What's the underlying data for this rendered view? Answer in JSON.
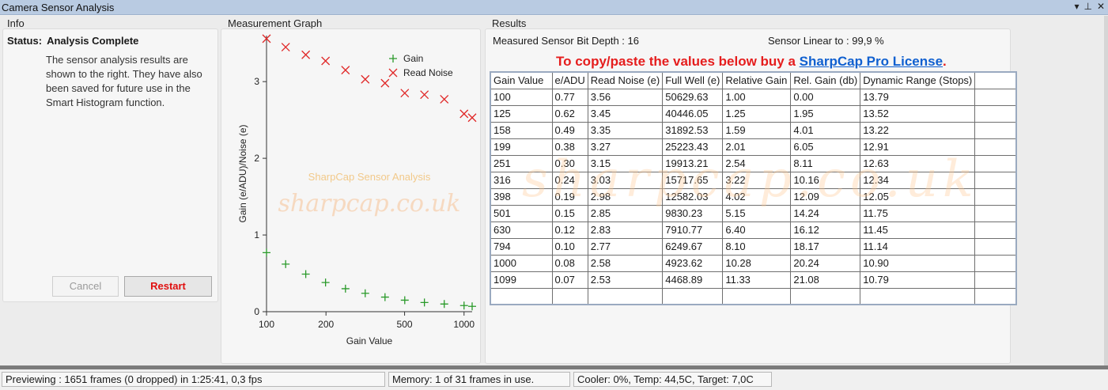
{
  "window": {
    "title": "Camera Sensor Analysis",
    "controls": [
      "▾",
      "⊥",
      "✕"
    ]
  },
  "info": {
    "title": "Info",
    "status_label": "Status:",
    "status_value": "Analysis Complete",
    "description": "The sensor analysis results are shown to the right. They have also been saved for future use in the Smart Histogram function.",
    "cancel_label": "Cancel",
    "restart_label": "Restart"
  },
  "graph": {
    "title": "Measurement Graph",
    "watermark_title": "SharpCap Sensor Analysis",
    "watermark_url": "sharpcap.co.uk"
  },
  "results": {
    "title": "Results",
    "bit_depth_label": "Measured Sensor Bit Depth :",
    "bit_depth_value": "16",
    "linear_label": "Sensor Linear to :",
    "linear_value": "99,9 %",
    "promo_text": "To copy/paste the values below buy a ",
    "promo_link": "SharpCap Pro License",
    "promo_end": ".",
    "watermark": "sharpcap.co.uk",
    "columns": [
      "Gain Value",
      "e/ADU",
      "Read Noise (e)",
      "Full Well (e)",
      "Relative Gain",
      "Rel. Gain (db)",
      "Dynamic Range (Stops)"
    ],
    "rows": [
      [
        "100",
        "0.77",
        "3.56",
        "50629.63",
        "1.00",
        "0.00",
        "13.79"
      ],
      [
        "125",
        "0.62",
        "3.45",
        "40446.05",
        "1.25",
        "1.95",
        "13.52"
      ],
      [
        "158",
        "0.49",
        "3.35",
        "31892.53",
        "1.59",
        "4.01",
        "13.22"
      ],
      [
        "199",
        "0.38",
        "3.27",
        "25223.43",
        "2.01",
        "6.05",
        "12.91"
      ],
      [
        "251",
        "0.30",
        "3.15",
        "19913.21",
        "2.54",
        "8.11",
        "12.63"
      ],
      [
        "316",
        "0.24",
        "3.03",
        "15717.65",
        "3.22",
        "10.16",
        "12.34"
      ],
      [
        "398",
        "0.19",
        "2.98",
        "12582.03",
        "4.02",
        "12.09",
        "12.05"
      ],
      [
        "501",
        "0.15",
        "2.85",
        "9830.23",
        "5.15",
        "14.24",
        "11.75"
      ],
      [
        "630",
        "0.12",
        "2.83",
        "7910.77",
        "6.40",
        "16.12",
        "11.45"
      ],
      [
        "794",
        "0.10",
        "2.77",
        "6249.67",
        "8.10",
        "18.17",
        "11.14"
      ],
      [
        "1000",
        "0.08",
        "2.58",
        "4923.62",
        "10.28",
        "20.24",
        "10.90"
      ],
      [
        "1099",
        "0.07",
        "2.53",
        "4468.89",
        "11.33",
        "21.08",
        "10.79"
      ]
    ]
  },
  "statusbar": {
    "preview": "Previewing : 1651 frames (0 dropped) in 1:25:41, 0,3 fps",
    "memory": "Memory: 1 of 31 frames in use.",
    "cooler": "Cooler: 0%, Temp: 44,5C, Target: 7,0C"
  },
  "chart_data": {
    "type": "scatter",
    "title": "",
    "xlabel": "Gain Value",
    "ylabel": "Gain (e/ADU)/Noise (e)",
    "xscale": "log",
    "xlim": [
      100,
      1099
    ],
    "ylim": [
      0,
      3.6
    ],
    "xticks": [
      100,
      200,
      500,
      1000
    ],
    "yticks": [
      0,
      1,
      2,
      3
    ],
    "legend": "top-right",
    "colors": {
      "gain": "#2a9a2a",
      "noise": "#e02828"
    },
    "series": [
      {
        "name": "Gain",
        "marker": "+",
        "x": [
          100,
          125,
          158,
          199,
          251,
          316,
          398,
          501,
          630,
          794,
          1000,
          1099
        ],
        "y": [
          0.77,
          0.62,
          0.49,
          0.38,
          0.3,
          0.24,
          0.19,
          0.15,
          0.12,
          0.1,
          0.08,
          0.07
        ]
      },
      {
        "name": "Read Noise",
        "marker": "x",
        "x": [
          100,
          125,
          158,
          199,
          251,
          316,
          398,
          501,
          630,
          794,
          1000,
          1099
        ],
        "y": [
          3.56,
          3.45,
          3.35,
          3.27,
          3.15,
          3.03,
          2.98,
          2.85,
          2.83,
          2.77,
          2.58,
          2.53
        ]
      }
    ]
  }
}
